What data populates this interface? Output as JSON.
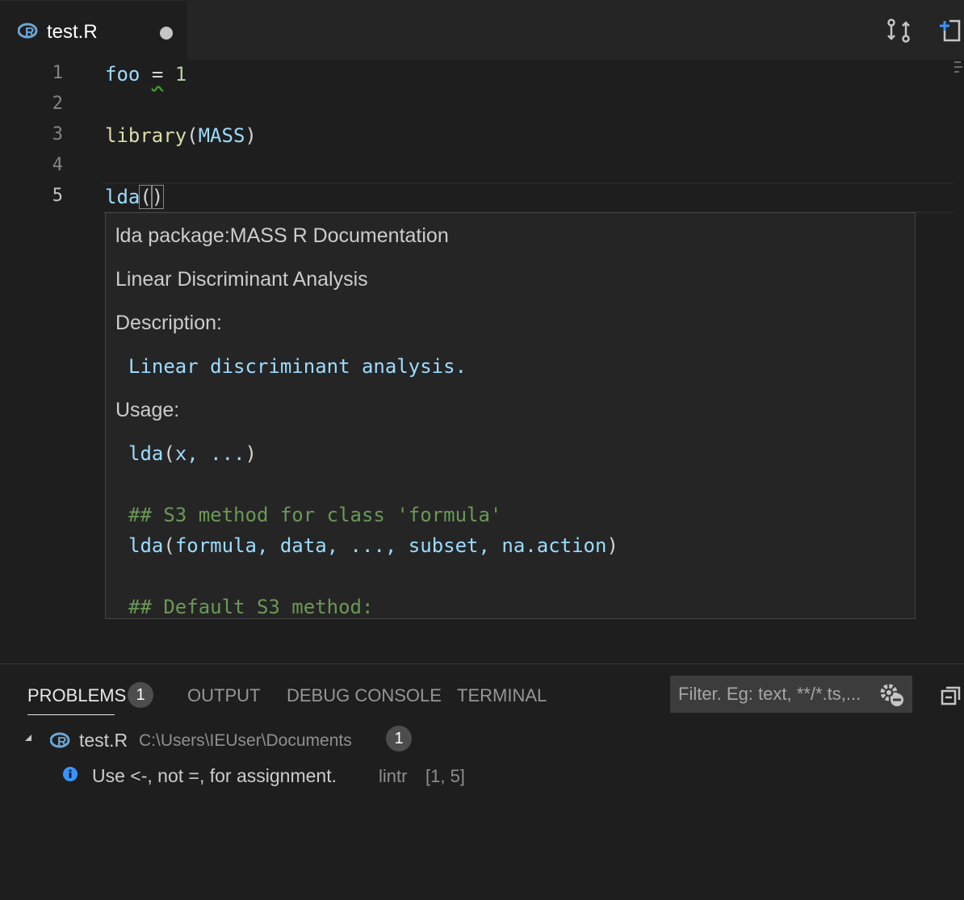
{
  "tab": {
    "filename": "test.R",
    "modified_dot": "●"
  },
  "editor": {
    "lines": [
      {
        "number": "1",
        "tokens": [
          "foo",
          " ",
          "=",
          " ",
          "1"
        ]
      },
      {
        "number": "2"
      },
      {
        "number": "3",
        "tokens": [
          "library",
          "(",
          "MASS",
          ")"
        ]
      },
      {
        "number": "4"
      },
      {
        "number": "5",
        "tokens": [
          "lda",
          "(",
          ")"
        ]
      }
    ]
  },
  "hover": {
    "title": "lda package:MASS R Documentation",
    "subtitle": "Linear Discriminant Analysis",
    "description_label": "Description:",
    "description": "Linear discriminant analysis.",
    "usage_label": "Usage:",
    "usage1_fn": "lda",
    "usage1_args": "x, ...",
    "usage2": "## S3 method for class 'formula'",
    "usage3_fn": "lda",
    "usage3_args": "formula, data, ..., subset, na.action",
    "usage4": "## Default S3 method:"
  },
  "panel": {
    "tabs": {
      "problems": "PROBLEMS",
      "output": "OUTPUT",
      "debug_console": "DEBUG CONSOLE",
      "terminal": "TERMINAL"
    },
    "problems_count": "1",
    "filter_placeholder": "Filter. Eg: text, **/*.ts,...",
    "file": {
      "name": "test.R",
      "path": "C:\\Users\\IEUser\\Documents",
      "count": "1"
    },
    "problem": {
      "message": "Use <-, not =, for assignment.",
      "source": "lintr",
      "position": "[1, 5]"
    }
  },
  "colors": {
    "background": "#1e1e1e",
    "tabbar": "#252526",
    "info": "#3794ff",
    "variable": "#9cdcfe",
    "function": "#dcdcaa",
    "number": "#b5cea8",
    "comment": "#6a9955"
  }
}
